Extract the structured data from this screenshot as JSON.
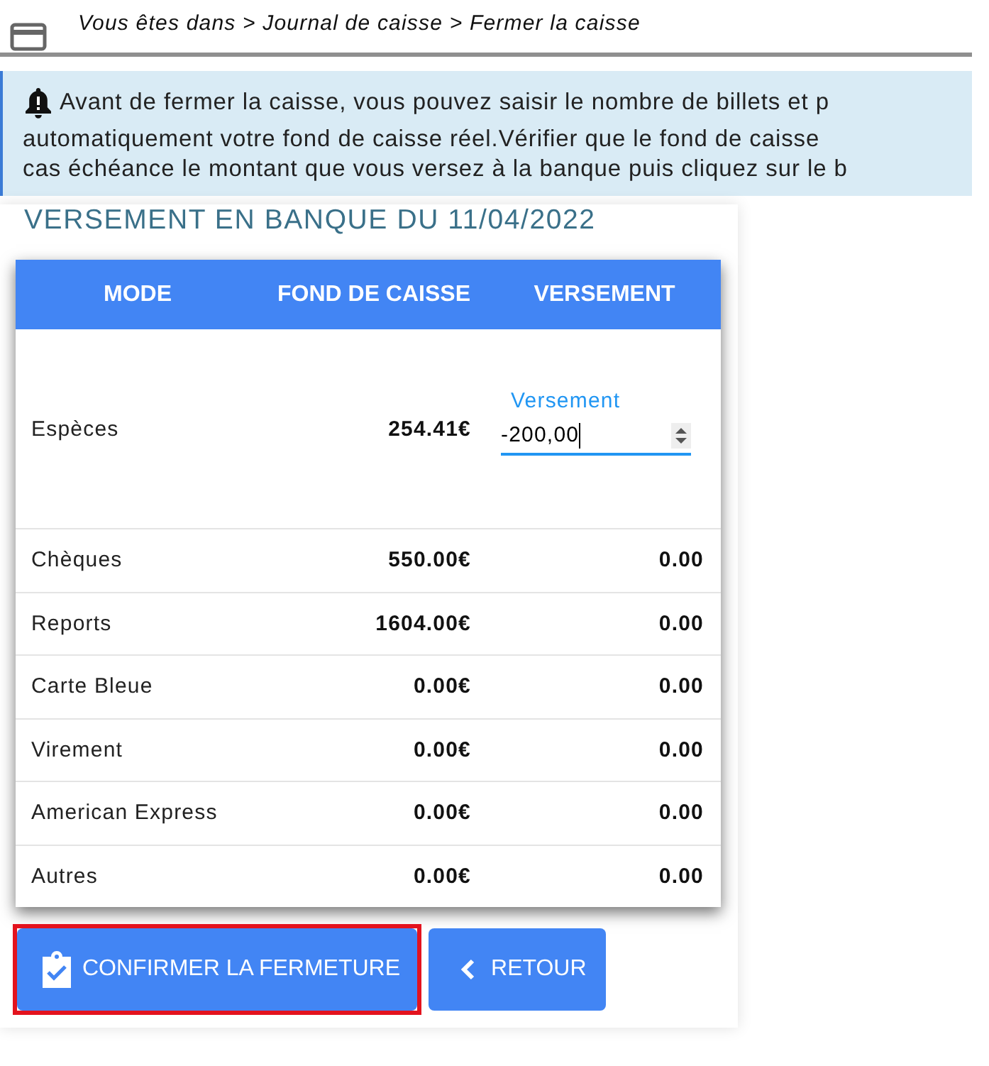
{
  "breadcrumb": "Vous êtes dans > Journal de caisse > Fermer la caisse",
  "notice": {
    "lines": [
      "Avant de fermer la caisse, vous pouvez saisir le nombre de billets et p",
      "automatiquement votre fond de caisse réel.Vérifier que le fond de caisse",
      "cas échéance le montant que vous versez à la banque puis cliquez sur le b"
    ]
  },
  "title": "VERSEMENT EN BANQUE DU 11/04/2022",
  "table": {
    "columns": [
      "MODE",
      "FOND DE CAISSE",
      "VERSEMENT"
    ],
    "rows": [
      {
        "kind": "input",
        "mode": "Espèces",
        "fond": "254.41€",
        "field_label": "Versement",
        "value": "-200,00"
      },
      {
        "kind": "text",
        "mode": "Chèques",
        "fond": "550.00€",
        "versement": "0.00"
      },
      {
        "kind": "text",
        "mode": "Reports",
        "fond": "1604.00€",
        "versement": "0.00"
      },
      {
        "kind": "text",
        "mode": "Carte Bleue",
        "fond": "0.00€",
        "versement": "0.00"
      },
      {
        "kind": "text",
        "mode": "Virement",
        "fond": "0.00€",
        "versement": "0.00"
      },
      {
        "kind": "text",
        "mode": "American Express",
        "fond": "0.00€",
        "versement": "0.00"
      },
      {
        "kind": "text",
        "mode": "Autres",
        "fond": "0.00€",
        "versement": "0.00"
      }
    ]
  },
  "buttons": [
    {
      "kind": "confirm",
      "label": "CONFIRMER LA FERMETURE",
      "highlighted": true
    },
    {
      "kind": "back",
      "label": "RETOUR",
      "highlighted": false
    }
  ]
}
